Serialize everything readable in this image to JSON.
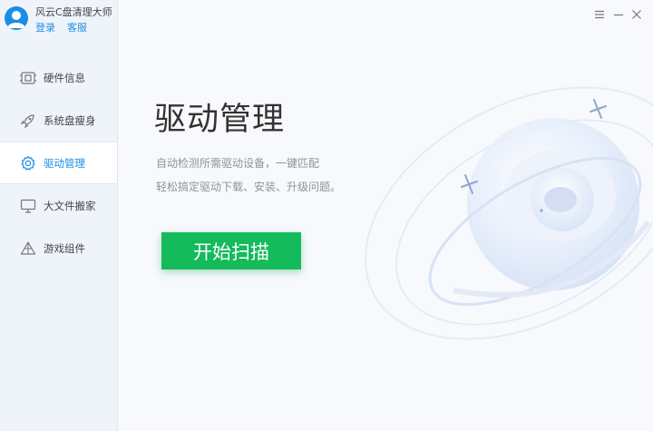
{
  "app": {
    "name": "风云C盘清理大师",
    "login_label": "登录",
    "service_label": "客服"
  },
  "sidebar": {
    "items": [
      {
        "label": "硬件信息",
        "icon": "hardware-icon",
        "active": false
      },
      {
        "label": "系统盘瘦身",
        "icon": "rocket-icon",
        "active": false
      },
      {
        "label": "驱动管理",
        "icon": "gear-icon",
        "active": true
      },
      {
        "label": "大文件搬家",
        "icon": "monitor-icon",
        "active": false
      },
      {
        "label": "游戏组件",
        "icon": "game-icon",
        "active": false
      }
    ]
  },
  "window_controls": [
    "menu-icon",
    "minimize-icon",
    "close-icon"
  ],
  "main": {
    "title": "驱动管理",
    "desc_line1": "自动检测所需驱动设备，一键匹配",
    "desc_line2": "轻松搞定驱动下载、安装、升级问题。",
    "start_button": "开始扫描"
  },
  "colors": {
    "accent": "#1a8ee6",
    "start_button": "#15ba5b",
    "sidebar_bg": "#eff4fb",
    "main_bg": "#f7f9fc"
  }
}
